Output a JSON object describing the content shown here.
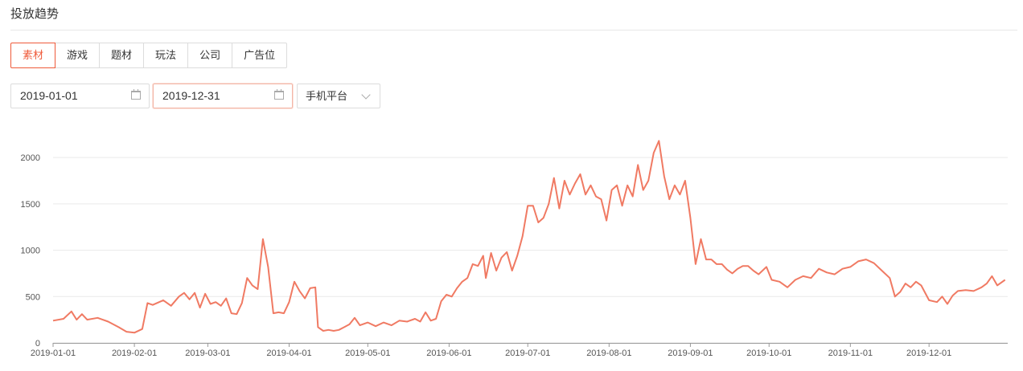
{
  "header": {
    "title": "投放趋势"
  },
  "tabs": [
    {
      "label": "素材",
      "active": true
    },
    {
      "label": "游戏",
      "active": false
    },
    {
      "label": "题材",
      "active": false
    },
    {
      "label": "玩法",
      "active": false
    },
    {
      "label": "公司",
      "active": false
    },
    {
      "label": "广告位",
      "active": false
    }
  ],
  "filters": {
    "start_date": "2019-01-01",
    "end_date": "2019-12-31",
    "platform": "手机平台",
    "start_icon": "calendar-icon",
    "end_icon": "calendar-icon",
    "platform_icon": "chevron-down-icon"
  },
  "colors": {
    "accent": "#ef5a3a",
    "line": "#f07a63",
    "grid": "#e9e9e9"
  },
  "chart_data": {
    "type": "line",
    "title": "",
    "xlabel": "",
    "ylabel": "",
    "ylim": [
      0,
      2400
    ],
    "yticks": [
      0,
      500,
      1000,
      1500,
      2000
    ],
    "grid": true,
    "legend": "none",
    "xticks": [
      "2019-01-01",
      "2019-02-01",
      "2019-03-01",
      "2019-04-01",
      "2019-05-01",
      "2019-06-01",
      "2019-07-01",
      "2019-08-01",
      "2019-09-01",
      "2019-10-01",
      "2019-11-01",
      "2019-12-01"
    ],
    "series": [
      {
        "points": [
          [
            "2019-01-01",
            240
          ],
          [
            "2019-01-05",
            260
          ],
          [
            "2019-01-08",
            340
          ],
          [
            "2019-01-10",
            250
          ],
          [
            "2019-01-12",
            310
          ],
          [
            "2019-01-14",
            250
          ],
          [
            "2019-01-18",
            270
          ],
          [
            "2019-01-22",
            230
          ],
          [
            "2019-01-26",
            170
          ],
          [
            "2019-01-29",
            120
          ],
          [
            "2019-02-01",
            110
          ],
          [
            "2019-02-04",
            150
          ],
          [
            "2019-02-06",
            430
          ],
          [
            "2019-02-08",
            410
          ],
          [
            "2019-02-12",
            460
          ],
          [
            "2019-02-15",
            400
          ],
          [
            "2019-02-18",
            500
          ],
          [
            "2019-02-20",
            540
          ],
          [
            "2019-02-22",
            470
          ],
          [
            "2019-02-24",
            540
          ],
          [
            "2019-02-26",
            380
          ],
          [
            "2019-02-28",
            530
          ],
          [
            "2019-03-02",
            420
          ],
          [
            "2019-03-04",
            440
          ],
          [
            "2019-03-06",
            400
          ],
          [
            "2019-03-08",
            480
          ],
          [
            "2019-03-10",
            320
          ],
          [
            "2019-03-12",
            310
          ],
          [
            "2019-03-14",
            430
          ],
          [
            "2019-03-16",
            700
          ],
          [
            "2019-03-18",
            620
          ],
          [
            "2019-03-20",
            580
          ],
          [
            "2019-03-22",
            1120
          ],
          [
            "2019-03-24",
            820
          ],
          [
            "2019-03-26",
            320
          ],
          [
            "2019-03-28",
            330
          ],
          [
            "2019-03-30",
            320
          ],
          [
            "2019-04-01",
            440
          ],
          [
            "2019-04-03",
            660
          ],
          [
            "2019-04-05",
            560
          ],
          [
            "2019-04-07",
            480
          ],
          [
            "2019-04-09",
            590
          ],
          [
            "2019-04-11",
            600
          ],
          [
            "2019-04-12",
            170
          ],
          [
            "2019-04-14",
            130
          ],
          [
            "2019-04-16",
            140
          ],
          [
            "2019-04-18",
            130
          ],
          [
            "2019-04-20",
            140
          ],
          [
            "2019-04-22",
            170
          ],
          [
            "2019-04-24",
            200
          ],
          [
            "2019-04-26",
            270
          ],
          [
            "2019-04-28",
            190
          ],
          [
            "2019-05-01",
            220
          ],
          [
            "2019-05-04",
            180
          ],
          [
            "2019-05-07",
            220
          ],
          [
            "2019-05-10",
            190
          ],
          [
            "2019-05-13",
            240
          ],
          [
            "2019-05-16",
            230
          ],
          [
            "2019-05-19",
            260
          ],
          [
            "2019-05-21",
            230
          ],
          [
            "2019-05-23",
            330
          ],
          [
            "2019-05-25",
            240
          ],
          [
            "2019-05-27",
            260
          ],
          [
            "2019-05-29",
            450
          ],
          [
            "2019-05-31",
            520
          ],
          [
            "2019-06-02",
            500
          ],
          [
            "2019-06-04",
            590
          ],
          [
            "2019-06-06",
            660
          ],
          [
            "2019-06-08",
            700
          ],
          [
            "2019-06-10",
            850
          ],
          [
            "2019-06-12",
            830
          ],
          [
            "2019-06-14",
            940
          ],
          [
            "2019-06-15",
            700
          ],
          [
            "2019-06-17",
            970
          ],
          [
            "2019-06-19",
            780
          ],
          [
            "2019-06-21",
            920
          ],
          [
            "2019-06-23",
            980
          ],
          [
            "2019-06-25",
            780
          ],
          [
            "2019-06-27",
            940
          ],
          [
            "2019-06-29",
            1150
          ],
          [
            "2019-07-01",
            1480
          ],
          [
            "2019-07-03",
            1480
          ],
          [
            "2019-07-05",
            1300
          ],
          [
            "2019-07-07",
            1350
          ],
          [
            "2019-07-09",
            1500
          ],
          [
            "2019-07-11",
            1780
          ],
          [
            "2019-07-13",
            1450
          ],
          [
            "2019-07-15",
            1750
          ],
          [
            "2019-07-17",
            1600
          ],
          [
            "2019-07-19",
            1720
          ],
          [
            "2019-07-21",
            1820
          ],
          [
            "2019-07-23",
            1600
          ],
          [
            "2019-07-25",
            1700
          ],
          [
            "2019-07-27",
            1580
          ],
          [
            "2019-07-29",
            1550
          ],
          [
            "2019-07-31",
            1320
          ],
          [
            "2019-08-02",
            1650
          ],
          [
            "2019-08-04",
            1700
          ],
          [
            "2019-08-06",
            1480
          ],
          [
            "2019-08-08",
            1700
          ],
          [
            "2019-08-10",
            1580
          ],
          [
            "2019-08-12",
            1920
          ],
          [
            "2019-08-14",
            1650
          ],
          [
            "2019-08-16",
            1750
          ],
          [
            "2019-08-18",
            2050
          ],
          [
            "2019-08-20",
            2180
          ],
          [
            "2019-08-22",
            1800
          ],
          [
            "2019-08-24",
            1550
          ],
          [
            "2019-08-26",
            1700
          ],
          [
            "2019-08-28",
            1600
          ],
          [
            "2019-08-30",
            1750
          ],
          [
            "2019-09-01",
            1350
          ],
          [
            "2019-09-03",
            850
          ],
          [
            "2019-09-05",
            1120
          ],
          [
            "2019-09-07",
            900
          ],
          [
            "2019-09-09",
            900
          ],
          [
            "2019-09-11",
            850
          ],
          [
            "2019-09-13",
            850
          ],
          [
            "2019-09-15",
            790
          ],
          [
            "2019-09-17",
            750
          ],
          [
            "2019-09-19",
            800
          ],
          [
            "2019-09-21",
            830
          ],
          [
            "2019-09-23",
            830
          ],
          [
            "2019-09-25",
            780
          ],
          [
            "2019-09-27",
            740
          ],
          [
            "2019-09-30",
            820
          ],
          [
            "2019-10-02",
            680
          ],
          [
            "2019-10-05",
            660
          ],
          [
            "2019-10-08",
            600
          ],
          [
            "2019-10-11",
            680
          ],
          [
            "2019-10-14",
            720
          ],
          [
            "2019-10-17",
            700
          ],
          [
            "2019-10-20",
            800
          ],
          [
            "2019-10-23",
            760
          ],
          [
            "2019-10-26",
            740
          ],
          [
            "2019-10-29",
            800
          ],
          [
            "2019-11-01",
            820
          ],
          [
            "2019-11-04",
            880
          ],
          [
            "2019-11-07",
            900
          ],
          [
            "2019-11-10",
            860
          ],
          [
            "2019-11-13",
            780
          ],
          [
            "2019-11-16",
            700
          ],
          [
            "2019-11-18",
            500
          ],
          [
            "2019-11-20",
            550
          ],
          [
            "2019-11-22",
            640
          ],
          [
            "2019-11-24",
            600
          ],
          [
            "2019-11-26",
            660
          ],
          [
            "2019-11-28",
            620
          ],
          [
            "2019-12-01",
            460
          ],
          [
            "2019-12-04",
            440
          ],
          [
            "2019-12-06",
            500
          ],
          [
            "2019-12-08",
            420
          ],
          [
            "2019-12-10",
            510
          ],
          [
            "2019-12-12",
            560
          ],
          [
            "2019-12-15",
            570
          ],
          [
            "2019-12-18",
            560
          ],
          [
            "2019-12-21",
            600
          ],
          [
            "2019-12-23",
            640
          ],
          [
            "2019-12-25",
            720
          ],
          [
            "2019-12-27",
            620
          ],
          [
            "2019-12-30",
            680
          ]
        ]
      }
    ]
  }
}
